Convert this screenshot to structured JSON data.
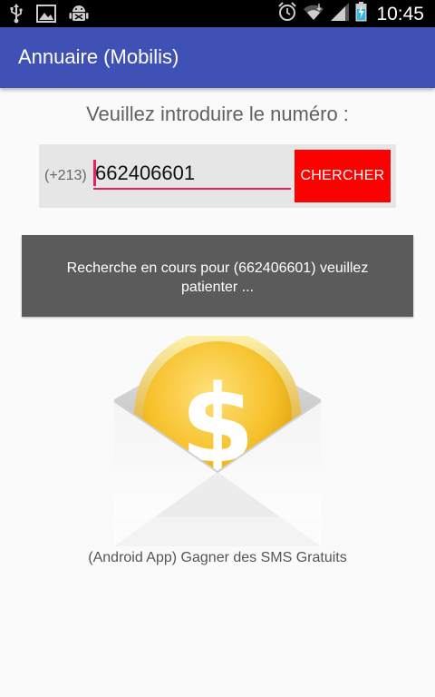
{
  "status_bar": {
    "time": "10:45",
    "left_icons": [
      "usb-icon",
      "image-icon",
      "android-debug-icon"
    ],
    "right_icons": [
      "alarm-icon",
      "wifi-icon",
      "signal-icon",
      "battery-charging-icon"
    ]
  },
  "app_bar": {
    "title": "Annuaire (Mobilis)",
    "color": "#3f51b5"
  },
  "search": {
    "prompt": "Veuillez introduire le numéro :",
    "prefix": "(+213)",
    "value": "662406601",
    "button_label": "CHERCHER",
    "button_color": "#ff0000",
    "underline_color": "#e91e63"
  },
  "progress": {
    "message": "Recherche en cours pour (662406601) veuillez patienter ..."
  },
  "ad": {
    "icon": "dollar-coin-envelope-icon",
    "caption": "(Android App) Gagner des SMS Gratuits"
  }
}
